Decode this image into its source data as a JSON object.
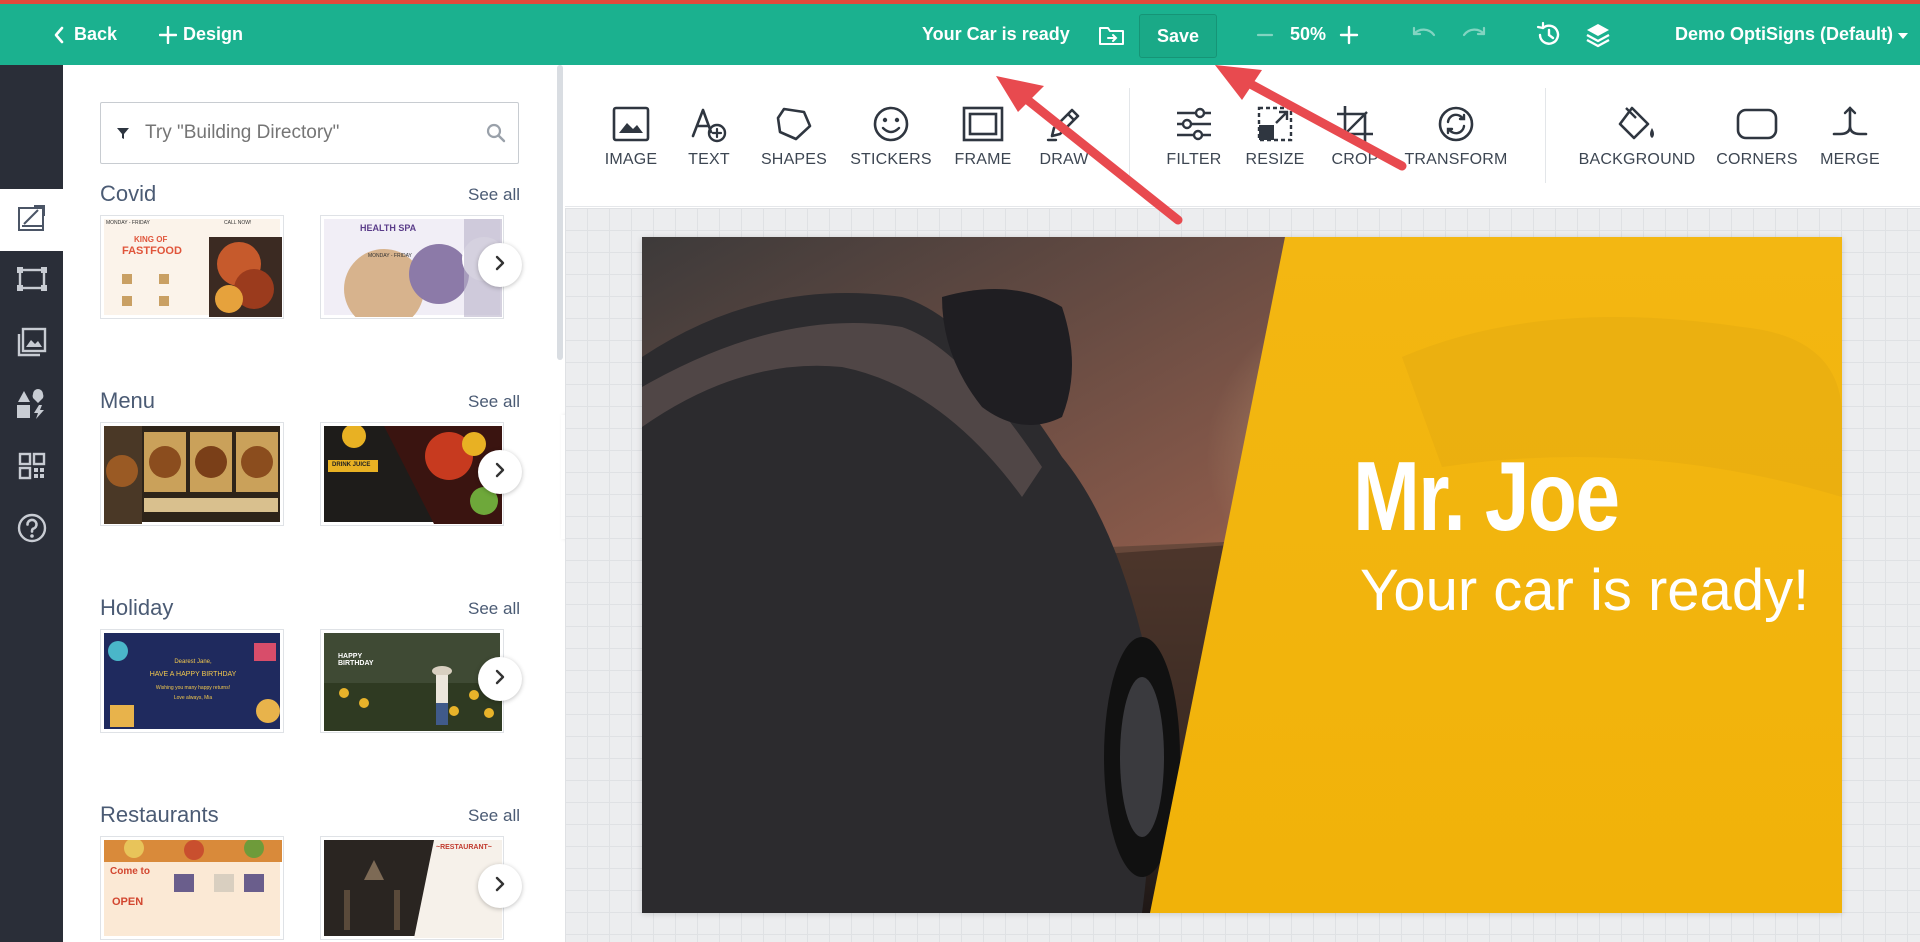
{
  "header": {
    "back_label": "Back",
    "design_label": "Design",
    "document_name": "Your Car is ready",
    "save_label": "Save",
    "zoom": "50%",
    "account": "Demo OptiSigns (Default)"
  },
  "panel": {
    "search_placeholder": "Try \"Building Directory\"",
    "sections": [
      {
        "title": "Covid",
        "see_all": "See all"
      },
      {
        "title": "Menu",
        "see_all": "See all"
      },
      {
        "title": "Holiday",
        "see_all": "See all"
      },
      {
        "title": "Restaurants",
        "see_all": "See all"
      }
    ]
  },
  "thumbnails": {
    "t1_badge": "KING OF",
    "t1_title": "FASTFOOD",
    "t1_top": "MONDAY - FRIDAY",
    "t1_call": "CALL NOW!",
    "t2_title": "HEALTH SPA",
    "t2_sub": "MONDAY - FRIDAY",
    "t4_label": "DRINK JUICE",
    "t5_line1": "Dearest Jane,",
    "t5_line2": "HAVE A HAPPY BIRTHDAY",
    "t5_line3": "Wishing you many happy returns!",
    "t5_line4": "Love always, Mia",
    "t6_title": "HAPPY BIRTHDAY",
    "t7_line1": "Come to",
    "t7_line2": "OPEN",
    "t8_title": "~RESTAURANT~"
  },
  "tools": [
    {
      "label": "IMAGE",
      "icon": "image-icon"
    },
    {
      "label": "TEXT",
      "icon": "text-icon"
    },
    {
      "label": "SHAPES",
      "icon": "shapes-icon"
    },
    {
      "label": "STICKERS",
      "icon": "stickers-icon"
    },
    {
      "label": "FRAME",
      "icon": "frame-icon"
    },
    {
      "label": "DRAW",
      "icon": "pencil-icon"
    },
    {
      "label": "FILTER",
      "icon": "sliders-icon"
    },
    {
      "label": "RESIZE",
      "icon": "resize-icon"
    },
    {
      "label": "CROP",
      "icon": "crop-icon"
    },
    {
      "label": "TRANSFORM",
      "icon": "transform-icon"
    },
    {
      "label": "BACKGROUND",
      "icon": "paint-bucket-icon"
    },
    {
      "label": "CORNERS",
      "icon": "corners-icon"
    },
    {
      "label": "MERGE",
      "icon": "merge-icon"
    }
  ],
  "canvas": {
    "headline": "Mr. Joe",
    "subline": "Your car is ready!"
  },
  "colors": {
    "brand": "#1bb18f",
    "rail": "#2a2e38",
    "accent_yellow": "#f3b712",
    "annotation_arrow": "#e84a4f"
  }
}
